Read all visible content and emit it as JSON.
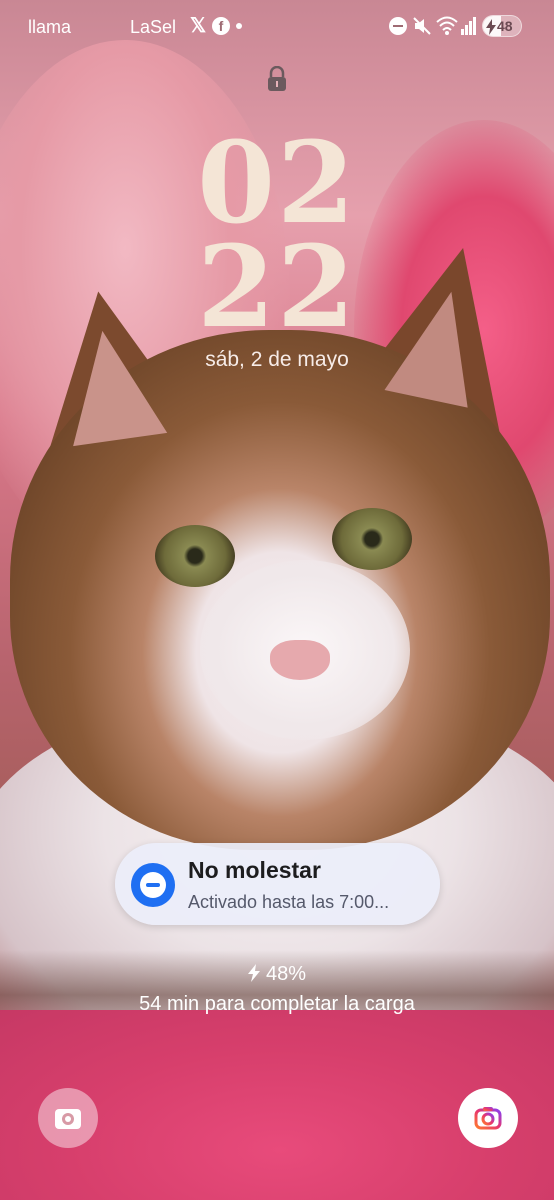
{
  "status_bar": {
    "notification_app_1": "llama",
    "notification_app_2": "LaSel",
    "battery_level": "48"
  },
  "clock": {
    "hour": "02",
    "minute": "22",
    "date": "sáb, 2 de mayo"
  },
  "dnd": {
    "title": "No molestar",
    "subtitle": "Activado hasta las 7:00..."
  },
  "charging": {
    "percent": "48%",
    "message": "54 min para completar la carga"
  },
  "icons": [
    "x-icon",
    "facebook-icon",
    "dnd-icon",
    "mute-icon",
    "wifi-icon",
    "signal-icon",
    "battery-icon",
    "lock-icon",
    "bolt-icon",
    "gallery-icon",
    "camera-icon"
  ],
  "colors": {
    "clock": "#f4e5d6",
    "dnd_accent": "#1f6ff2",
    "blanket_pink": "#e84b7b"
  }
}
